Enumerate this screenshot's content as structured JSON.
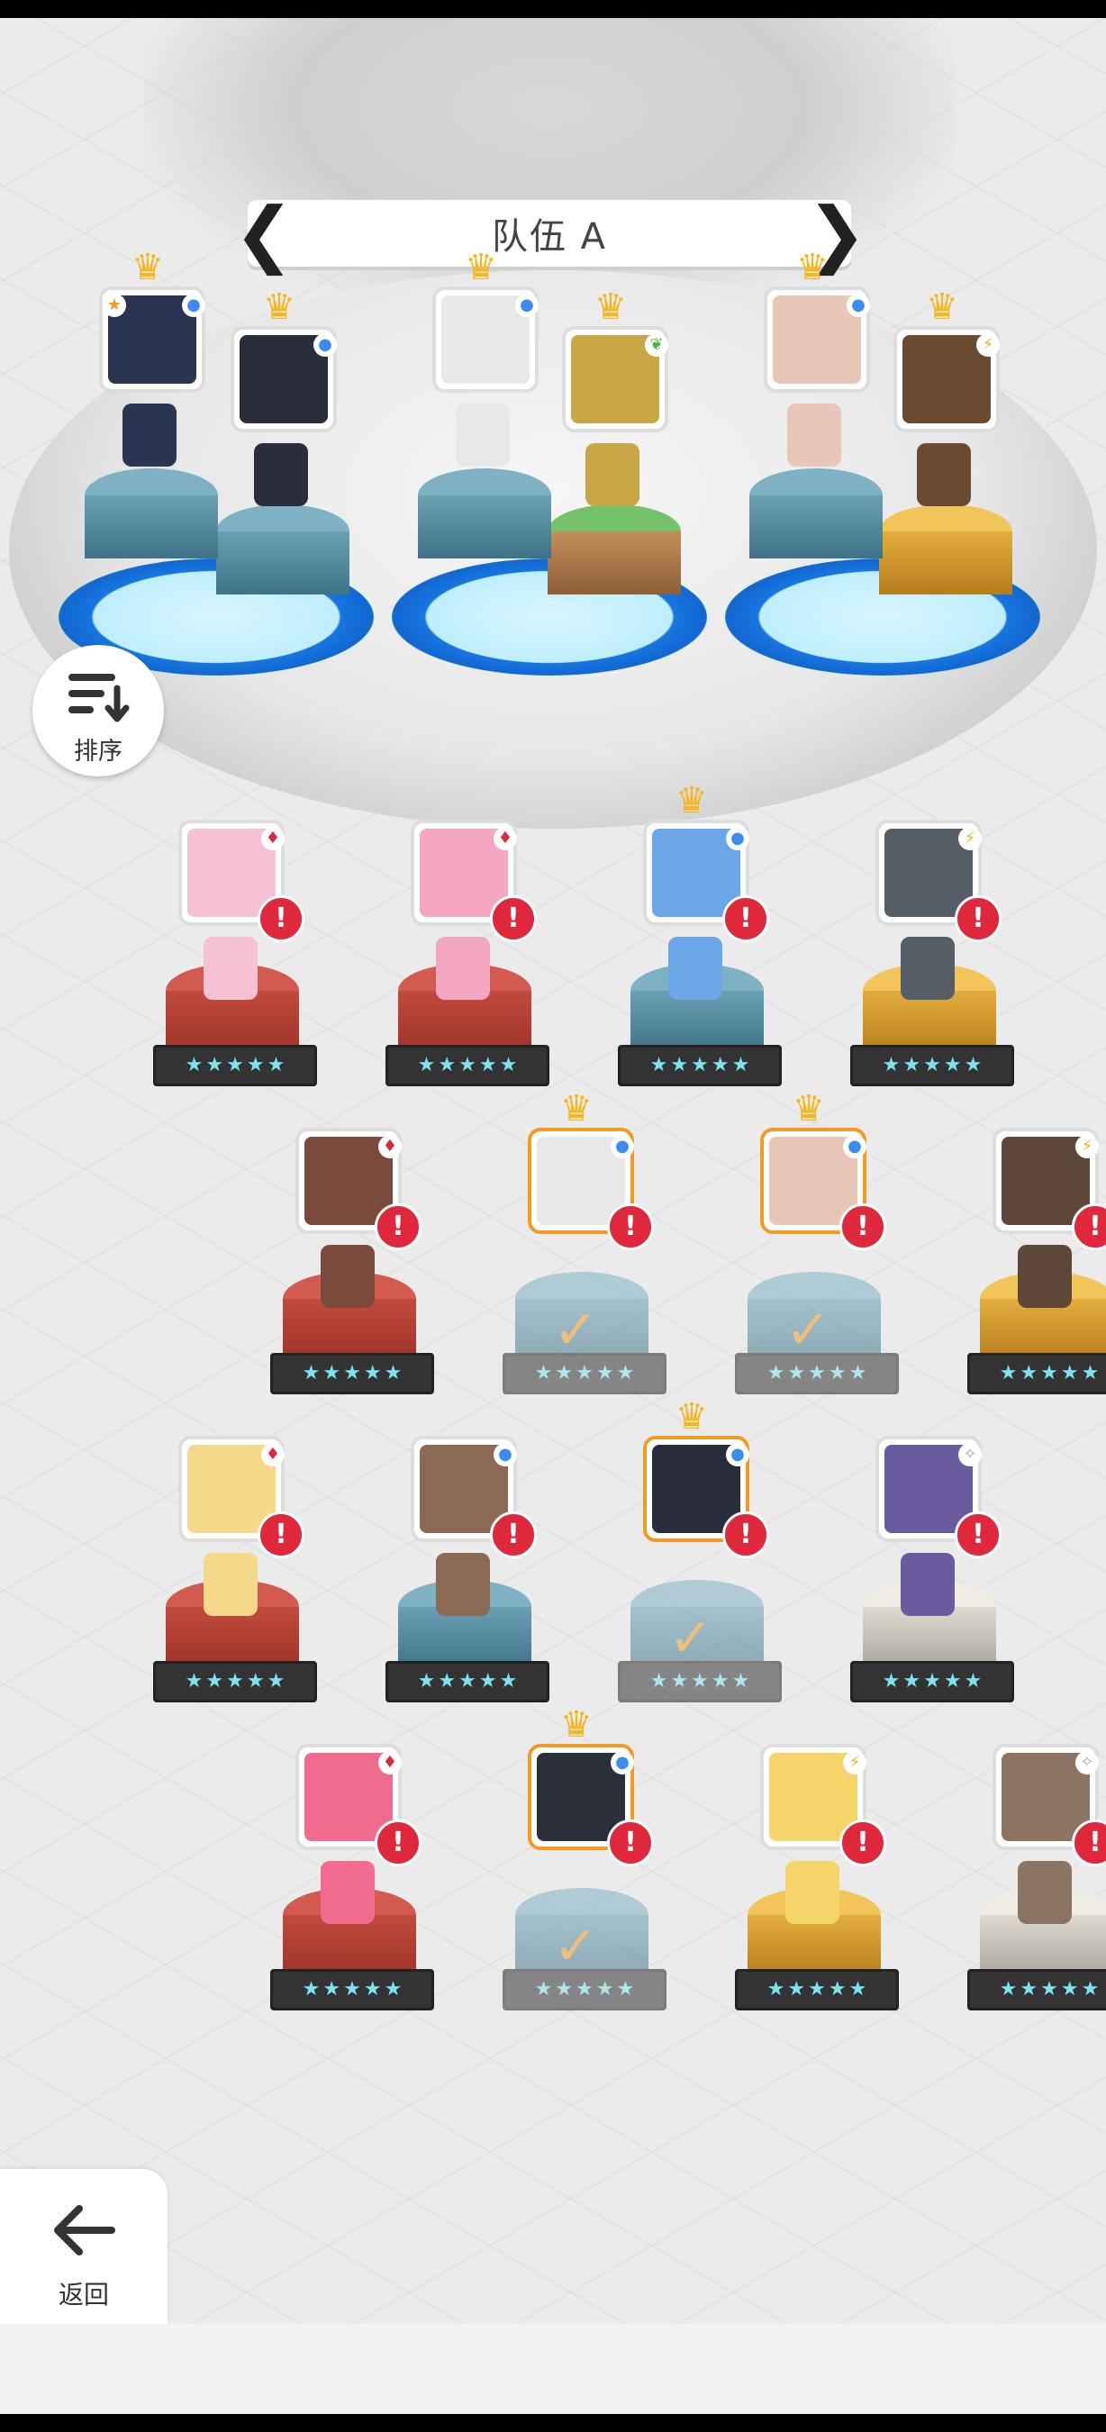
{
  "team": {
    "title": "队伍 A",
    "prev_arrow": "❮",
    "next_arrow": "❯"
  },
  "buttons": {
    "sort_label": "排序",
    "back_label": "返回"
  },
  "glyphs": {
    "star": "★",
    "check": "✓",
    "alert": "!",
    "crown": "♛",
    "water": "●",
    "fire": "♦",
    "thunder": "⚡",
    "light": "✧",
    "leaf": "❦"
  },
  "colors": {
    "accent_orange": "#f49a22",
    "alert_red": "#e0283d",
    "water_blue": "#3a8cf2",
    "fire_red": "#e0283d",
    "thunder_gold": "#f2b319",
    "leaf_green": "#4bb54b",
    "light_gray": "#aaaaaa"
  },
  "lineup": [
    {
      "element": "water",
      "crown": true,
      "leader": true
    },
    {
      "element": "water",
      "crown": true
    },
    {
      "element": "water",
      "crown": true
    },
    {
      "element": "leaf",
      "crown": true
    },
    {
      "element": "water",
      "crown": true
    },
    {
      "element": "thunder",
      "crown": true
    }
  ],
  "roster": [
    {
      "element": "fire",
      "color": "red",
      "alert": true
    },
    {
      "element": "fire",
      "color": "red",
      "alert": true
    },
    {
      "element": "water",
      "color": "blue",
      "alert": true,
      "crown": true
    },
    {
      "element": "thunder",
      "color": "gold",
      "alert": true
    },
    {
      "element": "fire",
      "color": "red",
      "alert": true
    },
    {
      "element": "water",
      "color": "blue",
      "alert": true,
      "crown": true,
      "in_team": true
    },
    {
      "element": "water",
      "color": "blue",
      "alert": true,
      "crown": true,
      "in_team": true
    },
    {
      "element": "thunder",
      "color": "gold",
      "alert": true
    },
    {
      "element": "fire",
      "color": "red",
      "alert": true
    },
    {
      "element": "water",
      "color": "blue",
      "alert": true
    },
    {
      "element": "water",
      "color": "blue",
      "alert": true,
      "crown": true,
      "in_team": true
    },
    {
      "element": "light",
      "color": "white",
      "alert": true
    },
    {
      "element": "fire",
      "color": "red",
      "alert": true
    },
    {
      "element": "water",
      "color": "blue",
      "alert": true,
      "crown": true,
      "in_team": true
    },
    {
      "element": "thunder",
      "color": "gold",
      "alert": true
    },
    {
      "element": "light",
      "color": "white",
      "alert": true
    }
  ]
}
